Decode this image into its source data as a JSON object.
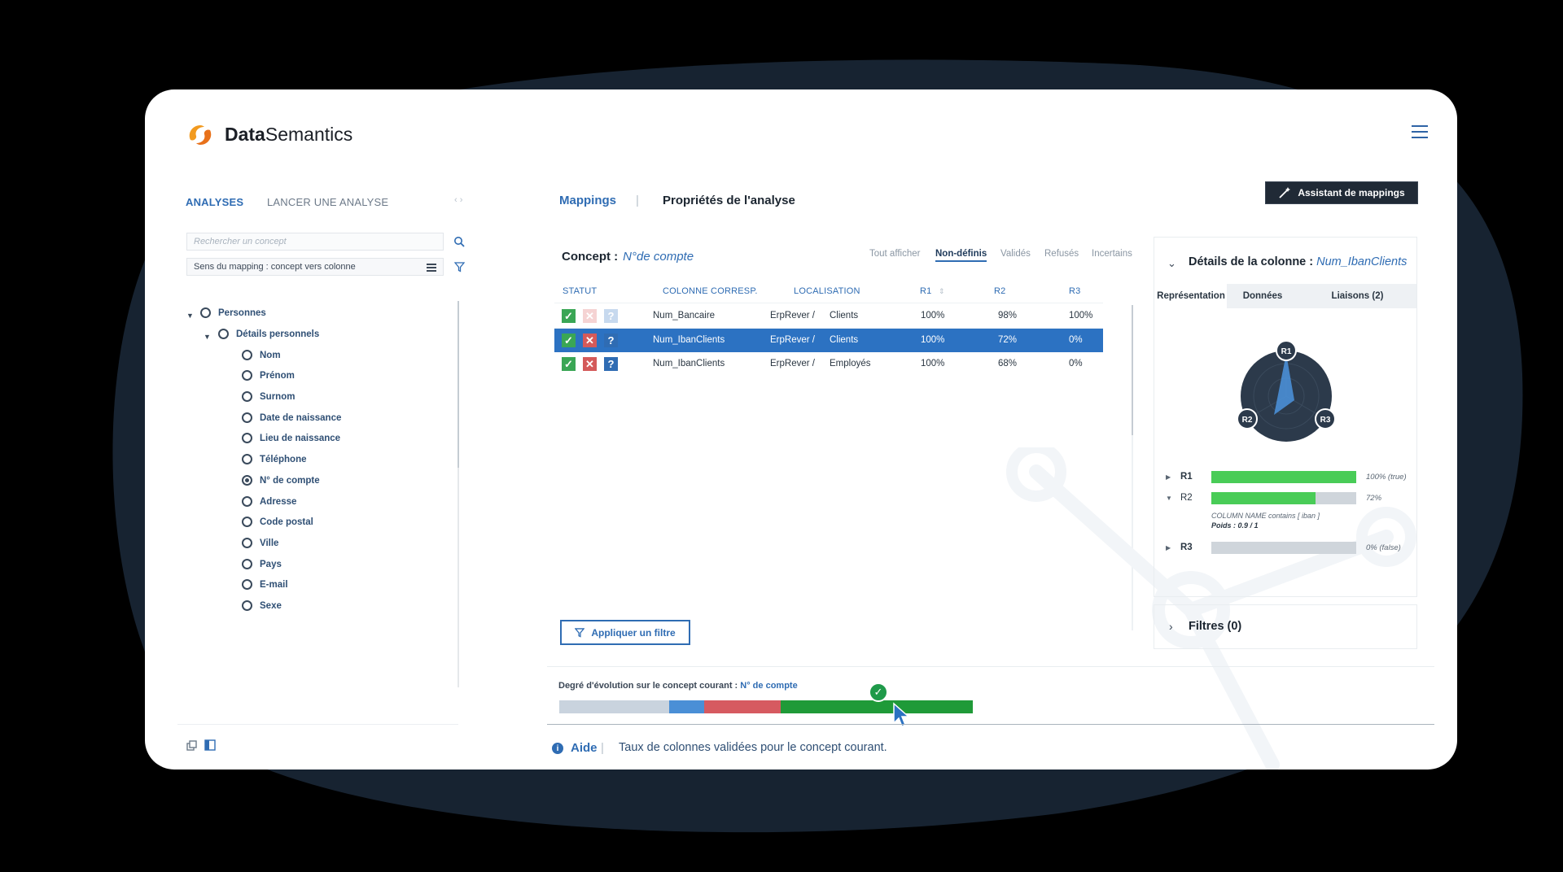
{
  "app": {
    "brand_bold": "Data",
    "brand_light": "Semantics",
    "accent": "#2f6cb3"
  },
  "left": {
    "tabs": [
      "ANALYSES",
      "LANCER UNE ANALYSE"
    ],
    "search_placeholder": "Rechercher un concept",
    "mapping_direction": "Sens du mapping : concept vers colonne",
    "tree": {
      "root": "Personnes",
      "group": "Détails personnels",
      "items": [
        "Nom",
        "Prénom",
        "Surnom",
        "Date de naissance",
        "Lieu de naissance",
        "Téléphone",
        "N° de compte",
        "Adresse",
        "Code postal",
        "Ville",
        "Pays",
        "E-mail",
        "Sexe"
      ],
      "selected": "N° de compte"
    }
  },
  "center": {
    "tabs": [
      "Mappings",
      "Propriétés de l'analyse"
    ],
    "separator": "|",
    "assistant_button": "Assistant de mappings",
    "concept_label": "Concept :",
    "concept_value": "N°de compte",
    "filters": [
      "Tout afficher",
      "Non-définis",
      "Validés",
      "Refusés",
      "Incertains"
    ],
    "active_filter": "Non-définis",
    "columns": [
      "STATUT",
      "COLONNE CORRESP.",
      "LOCALISATION",
      "R1",
      "R2",
      "R3"
    ],
    "rows": [
      {
        "column": "Num_Bancaire",
        "loc_a": "ErpRever /",
        "loc_b": "Clients",
        "r1": "100%",
        "r2": "98%",
        "r3": "100%"
      },
      {
        "column": "Num_IbanClients",
        "loc_a": "ErpRever /",
        "loc_b": "Clients",
        "r1": "100%",
        "r2": "72%",
        "r3": "0%"
      },
      {
        "column": "Num_IbanClients",
        "loc_a": "ErpRever /",
        "loc_b": "Employés",
        "r1": "100%",
        "r2": "68%",
        "r3": "0%"
      }
    ],
    "apply_filter_button": "Appliquer un filtre",
    "evolution_label": "Degré d'évolution sur le concept courant :",
    "evolution_concept": "N° de compte",
    "evolution_segments": [
      {
        "share": 0.265,
        "color": "#c9d3de"
      },
      {
        "share": 0.085,
        "color": "#4a8fd6"
      },
      {
        "share": 0.185,
        "color": "#d65a60"
      },
      {
        "share": 0.465,
        "color": "#1f9a38"
      }
    ],
    "help_link": "Aide",
    "help_separator": "|",
    "help_text": "Taux  de colonnes validées pour le concept courant."
  },
  "right": {
    "details_label": "Détails de la colonne :",
    "details_column": "Num_IbanClients",
    "tabs": [
      "Représentation",
      "Données",
      "Liaisons (2)"
    ],
    "radar_labels": [
      "R1",
      "R2",
      "R3"
    ],
    "bars": [
      {
        "name": "R1",
        "fraction": 1.0,
        "value": "100% (true)"
      },
      {
        "name": "R2",
        "fraction": 0.72,
        "value": "72%"
      },
      {
        "name": "R3",
        "fraction": 0.0,
        "value": "0% (false)"
      }
    ],
    "r2_note": "COLUMN NAME contains [ iban ]",
    "r2_weight": "Poids : 0.9 / 1",
    "filters_title": "Filtres (0)"
  }
}
